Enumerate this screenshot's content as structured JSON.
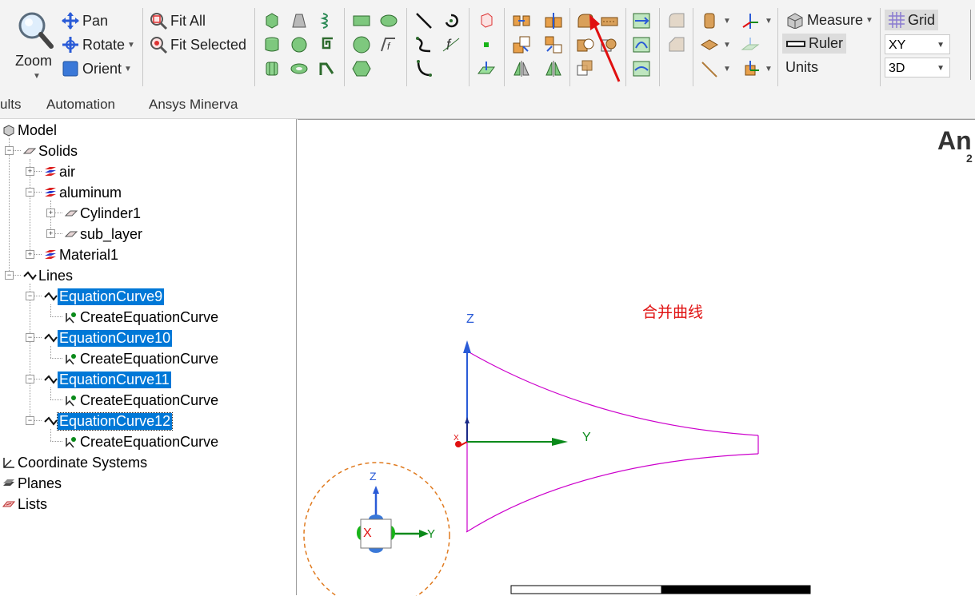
{
  "ribbon": {
    "zoom": "Zoom",
    "pan": "Pan",
    "rotate": "Rotate",
    "orient": "Orient",
    "fit_all": "Fit All",
    "fit_selected": "Fit Selected",
    "measure": "Measure",
    "ruler": "Ruler",
    "units": "Units",
    "grid": "Grid",
    "plane_select": "XY",
    "view_select": "3D"
  },
  "tabs": [
    "ults",
    "Automation",
    "Ansys Minerva"
  ],
  "tree": {
    "model": "Model",
    "solids": "Solids",
    "air": "air",
    "aluminum": "aluminum",
    "cylinder1": "Cylinder1",
    "sub_layer": "sub_layer",
    "material1": "Material1",
    "lines": "Lines",
    "curves": [
      {
        "name": "EquationCurve9",
        "child": "CreateEquationCurve"
      },
      {
        "name": "EquationCurve10",
        "child": "CreateEquationCurve"
      },
      {
        "name": "EquationCurve11",
        "child": "CreateEquationCurve"
      },
      {
        "name": "EquationCurve12",
        "child": "CreateEquationCurve"
      }
    ],
    "coord_systems": "Coordinate Systems",
    "planes": "Planes",
    "lists": "Lists"
  },
  "viewport": {
    "logo_text": "An",
    "logo_sub": "2",
    "annotation": "合并曲线",
    "axis_z": "Z",
    "axis_y": "Y",
    "axis_x": "X",
    "triad_z": "Z",
    "triad_y": "Y",
    "triad_x": "X"
  },
  "colors": {
    "selection": "#0078d7",
    "curve": "#cc00cc",
    "axis_z": "#2a5bd7",
    "axis_y": "#0a8a1a",
    "annotation": "#e01010"
  }
}
